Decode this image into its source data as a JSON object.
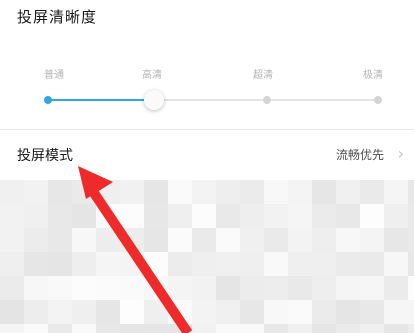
{
  "cast_quality": {
    "title": "投屏清晰度",
    "levels": [
      {
        "label": "普通"
      },
      {
        "label": "高清"
      },
      {
        "label": "超清"
      },
      {
        "label": "极清"
      }
    ],
    "selected_index": 1,
    "accent_color": "#33a8e0"
  },
  "cast_mode": {
    "label": "投屏模式",
    "value": "流畅优先",
    "chevron_icon": "chevron-right-icon"
  },
  "annotation": {
    "icon": "red-arrow-icon",
    "color": "#ee2a2a"
  }
}
